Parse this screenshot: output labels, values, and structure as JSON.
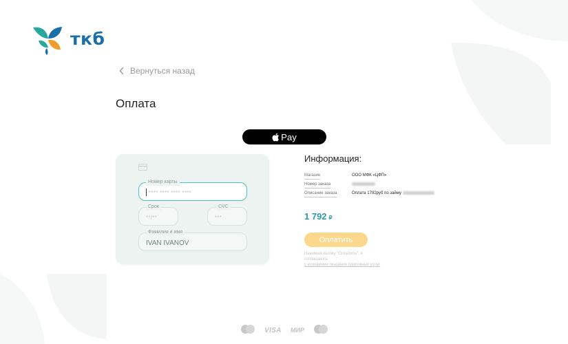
{
  "brand": {
    "logo_text": "ткб",
    "colors": {
      "teal": "#2aa6a0",
      "orange": "#f29b2d",
      "blue": "#1b6fa8",
      "accent": "#49c3b8"
    }
  },
  "nav": {
    "back_label": "Вернуться назад",
    "back_icon": "chevron-left-icon"
  },
  "page": {
    "title": "Оплата"
  },
  "apple_pay": {
    "label": "Pay",
    "icon": "apple-logo-icon"
  },
  "card_form": {
    "card_icon": "credit-card-icon",
    "card_number": {
      "label": "Номер карты",
      "placeholder": "**** **** **** ****"
    },
    "expiry": {
      "label": "Срок",
      "placeholder": "**/**"
    },
    "cvc": {
      "label": "CVC",
      "placeholder": "***"
    },
    "holder": {
      "label": "Фамилия и имя",
      "value": "IVAN IVANOV"
    }
  },
  "info": {
    "title": "Информация:",
    "rows": [
      {
        "label": "Магазин",
        "value": "ООО МФК «ЦФП»"
      },
      {
        "label": "Номер заказа",
        "value": ""
      },
      {
        "label": "Описание заказа",
        "value": "Оплата 1792руб по займу"
      }
    ]
  },
  "amount": {
    "value": "1 792",
    "currency": "₽"
  },
  "pay_button": {
    "label": "Оплатить"
  },
  "terms": {
    "line1": "Нажимая кнопку \"Оплатить\", я соглашаюсь",
    "line2": "с условиями оказания платежных услуг"
  },
  "payment_brands": {
    "visa": "VISA",
    "mir": "МИР"
  }
}
